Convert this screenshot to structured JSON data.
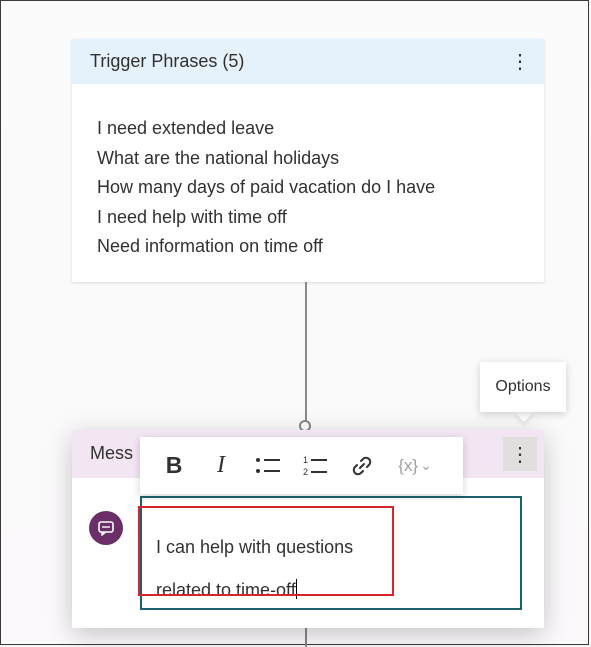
{
  "trigger_card": {
    "title": "Trigger Phrases (5)",
    "menu_glyph": "⋮",
    "phrases": [
      "I need extended leave",
      "What are the national holidays",
      "How many days of paid vacation do I have",
      "I need help with time off",
      "Need information on time off"
    ]
  },
  "tooltip": {
    "label": "Options"
  },
  "message_card": {
    "title": "Mess",
    "menu_glyph": "⋮",
    "avatar_icon": "chat-bubble-icon",
    "colors": {
      "header_bg": "#f3e6f3",
      "avatar": "#6b2e67",
      "editor_border": "#1f5f6e",
      "highlight": "#d9232d"
    }
  },
  "toolbar": {
    "bold_label": "B",
    "italic_label": "I",
    "bullet_list_icon": "bullet-list-icon",
    "numbered_list_icon": "numbered-list-icon",
    "link_icon": "link-icon",
    "variable_label": "{x}",
    "variable_chevron": "⌄"
  },
  "editor": {
    "line1": "I can help with questions",
    "line2": "related to time-off"
  },
  "colors": {
    "trigger_header_bg": "#e6f2fb"
  }
}
